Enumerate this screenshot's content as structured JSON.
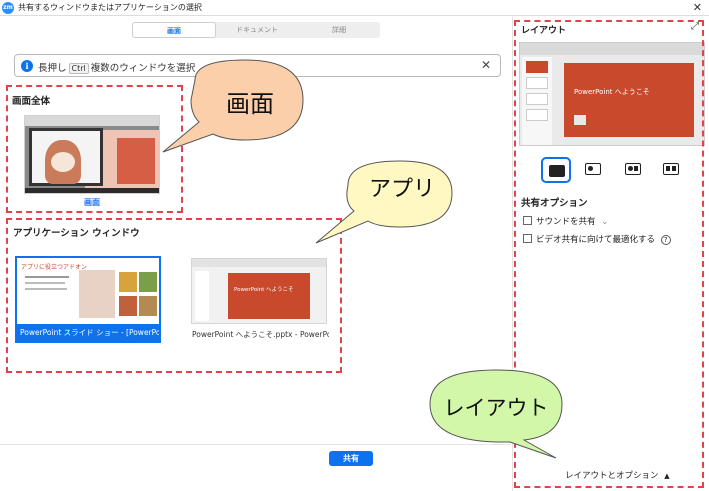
{
  "window": {
    "title": "共有するウィンドウまたはアプリケーションの選択",
    "logo_text": "zm",
    "close_glyph": "✕"
  },
  "tabs": [
    {
      "label": "画面",
      "active": true
    },
    {
      "label": "ドキュメント",
      "active": false
    },
    {
      "label": "詳細",
      "active": false
    }
  ],
  "search": {
    "icon": "info-icon",
    "hint_prefix": "長押し",
    "hint_key": "Ctrl",
    "hint_suffix": "複数のウィンドウを選択",
    "clear_glyph": "✕"
  },
  "screen_section": {
    "heading": "画面全体",
    "item_label": "画面"
  },
  "apps_section": {
    "heading": "アプリケーション ウィンドウ",
    "items": [
      {
        "label": "PowerPoint スライド ショー - [PowerPoint ...",
        "selected": true
      },
      {
        "label": "PowerPoint へようこそ.pptx - PowerPoint",
        "selected": false
      }
    ]
  },
  "thumb_texts": {
    "ppt_welcome": "PowerPoint へようこそ",
    "app_banner": "アプリに役立つアドオン"
  },
  "footer": {
    "share_label": "共有"
  },
  "right_panel": {
    "title": "レイアウト",
    "expand_glyph": "⤢",
    "options_title": "共有オプション",
    "options": [
      {
        "label": "サウンドを共有",
        "suffix": "⌄",
        "checked": false
      },
      {
        "label": "ビデオ共有に向けて最適化する",
        "suffix": "?",
        "checked": false
      }
    ],
    "footer_label": "レイアウトとオプション",
    "footer_glyph": "▲"
  },
  "callouts": {
    "screen": "画面",
    "app": "アプリ",
    "layout": "レイアウト"
  },
  "colors": {
    "accent": "#0e72ed",
    "dash": "#e0434c",
    "callout_orange": "#fbcfa9",
    "callout_yellow": "#fff8c2",
    "callout_green": "#d2f7a8",
    "ppt_red": "#c8492c"
  }
}
